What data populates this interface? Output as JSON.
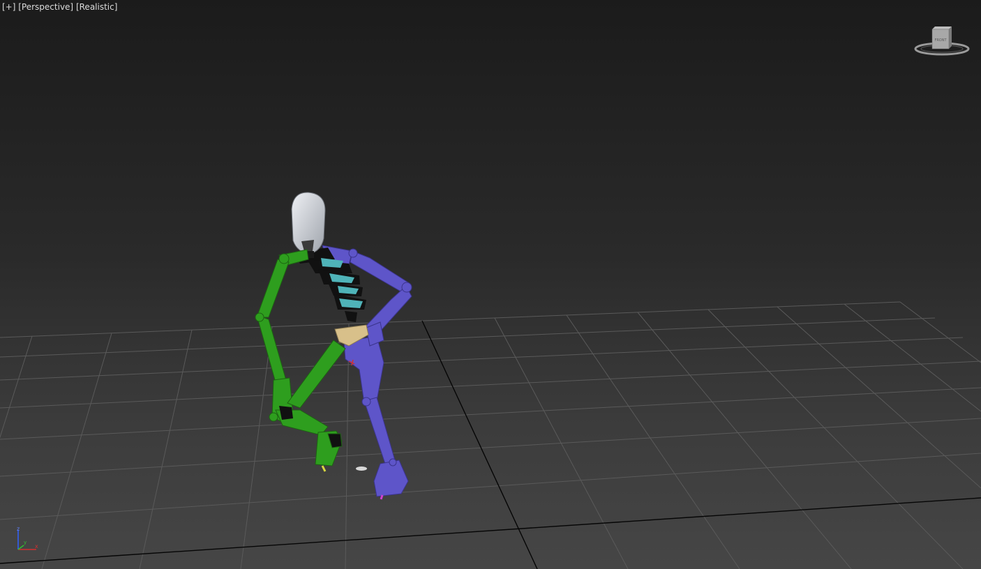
{
  "viewport": {
    "labels": {
      "plus": "[+]",
      "view": "[Perspective]",
      "shading": "[Realistic]"
    },
    "viewcube": {
      "face_label": "FRONT"
    },
    "axis_gizmo": {
      "x": "x",
      "y": "y",
      "z": "z"
    },
    "colors": {
      "left_limbs": "#2e9e1e",
      "right_limbs": "#5e55c9",
      "spine": "#4fb3b8",
      "head": "#c9ccd2",
      "pelvis": "#d8c08a",
      "grid": "#5a5a5a",
      "grid_main_axis": "#000000",
      "axis_x": "#d03030",
      "axis_y": "#30c030",
      "axis_z": "#3060ff"
    }
  }
}
